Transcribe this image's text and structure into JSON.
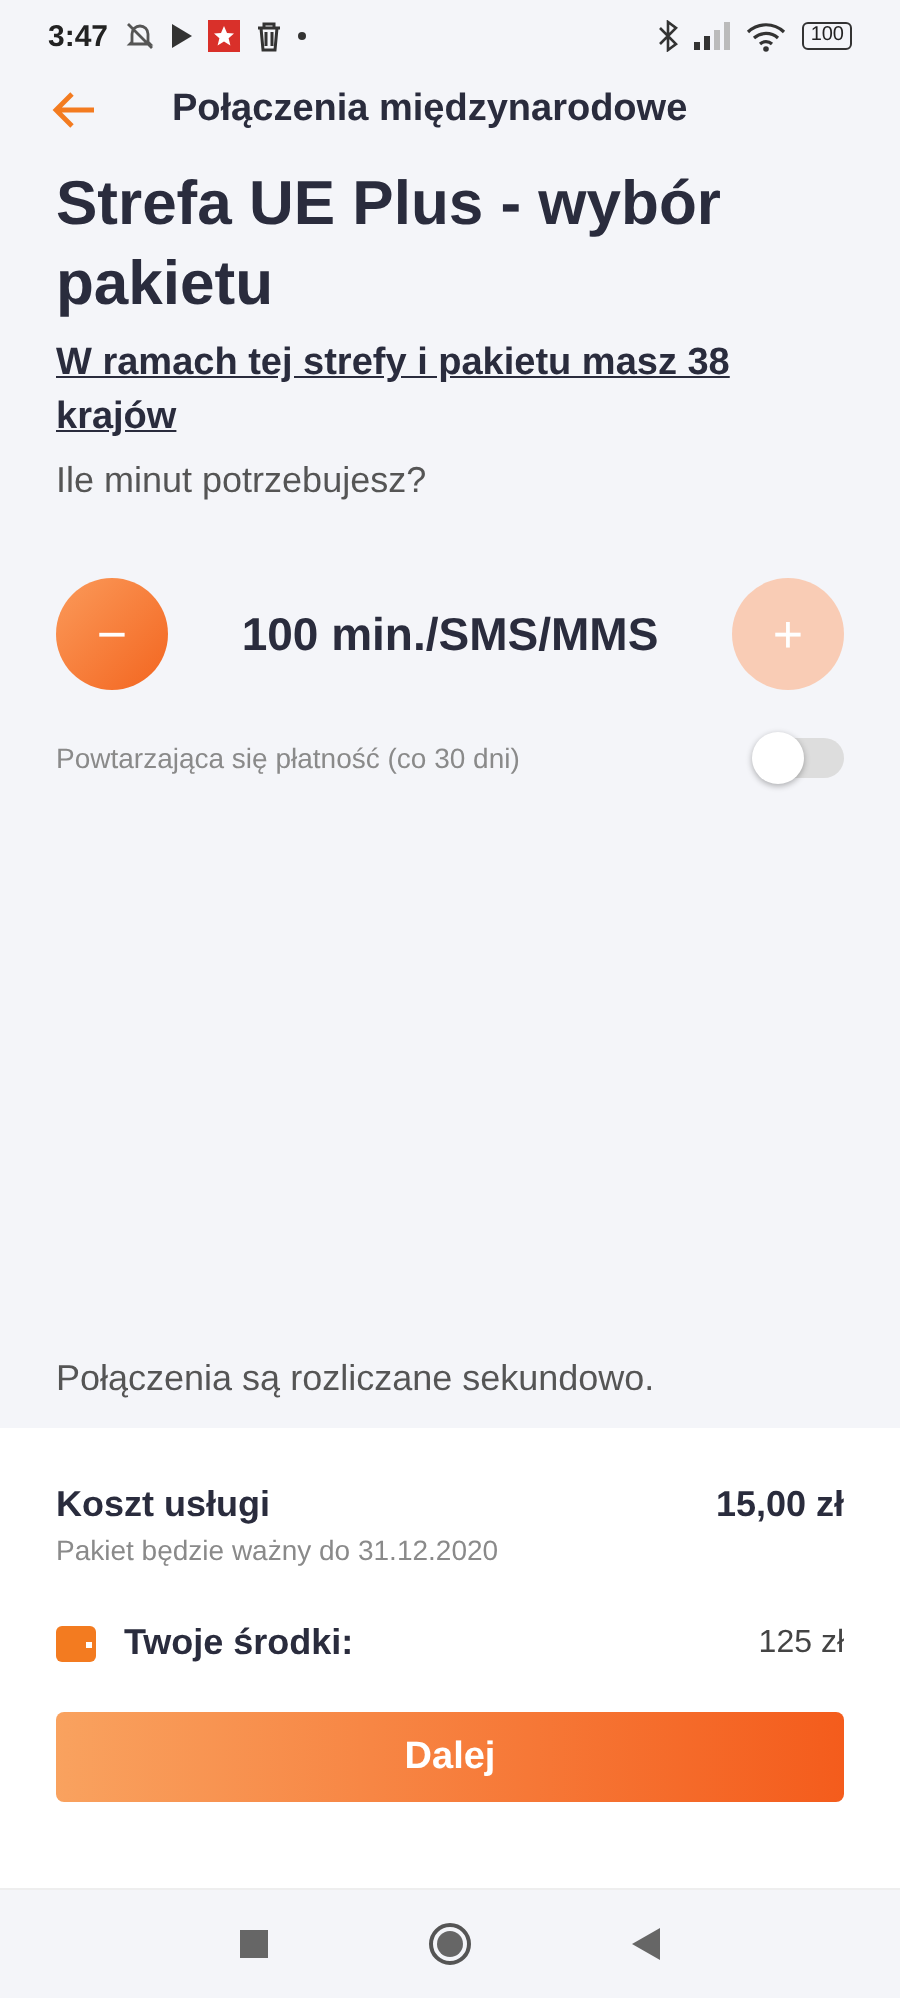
{
  "status_bar": {
    "time": "3:47",
    "battery": "100"
  },
  "header": {
    "title": "Połączenia międzynarodowe"
  },
  "heading": "Strefa UE Plus - wybór pakietu",
  "countries_link": "W ramach tej strefy i pakietu masz 38 krajów",
  "question": "Ile minut potrzebujesz?",
  "stepper": {
    "minus": {
      "label": "−",
      "disabled": false
    },
    "value": "100 min./SMS/MMS",
    "plus": {
      "label": "+",
      "disabled": true
    }
  },
  "recurring": {
    "label": "Powtarzająca się płatność (co 30 dni)",
    "on": false
  },
  "billing_note": "Połączenia są rozliczane sekundowo.",
  "summary": {
    "cost_label": "Koszt usługi",
    "cost_value": "15,00 zł",
    "validity": "Pakiet będzie ważny do 31.12.2020",
    "funds_label": "Twoje środki:",
    "funds_value": "125 zł"
  },
  "next_button": "Dalej"
}
